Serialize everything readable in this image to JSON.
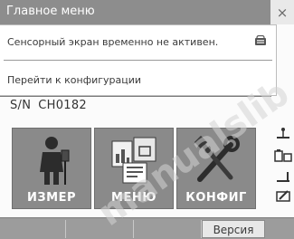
{
  "window": {
    "title": "Главное меню",
    "close_glyph": "×"
  },
  "popup": {
    "message": "Сенсорный экран временно не активен.",
    "message_icon": "keyboard-lock-icon",
    "link": "Перейти к конфигурации"
  },
  "device": {
    "serial_label": "S/N",
    "serial_value": "CH0182"
  },
  "buttons": [
    {
      "label": "ИЗМЕР",
      "icon": "surveyor-icon"
    },
    {
      "label": "МЕНЮ",
      "icon": "menu-documents-icon"
    },
    {
      "label": "КОНФИГ",
      "icon": "tools-icon"
    }
  ],
  "softkeys": {
    "version_label": "Версия"
  },
  "watermark": "manualslib"
}
